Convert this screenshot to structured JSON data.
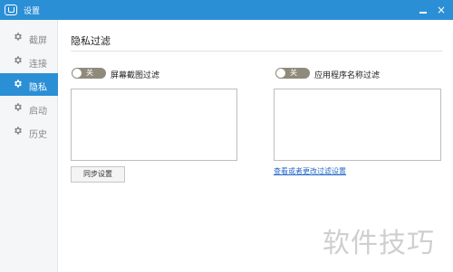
{
  "window": {
    "title": "设置",
    "minimize_glyph": "—",
    "close_glyph": "×"
  },
  "sidebar": {
    "items": [
      {
        "label": "截屏",
        "icon": "gear-icon",
        "active": false
      },
      {
        "label": "连接",
        "icon": "gear-icon",
        "active": false
      },
      {
        "label": "隐私",
        "icon": "gear-icon",
        "active": true
      },
      {
        "label": "启动",
        "icon": "gear-icon",
        "active": false
      },
      {
        "label": "历史",
        "icon": "gear-icon",
        "active": false
      }
    ]
  },
  "main": {
    "title": "隐私过滤",
    "screen_filter": {
      "toggle_state": "关",
      "label": "屏幕截图过滤"
    },
    "app_filter": {
      "toggle_state": "关",
      "label": "应用程序名称过滤"
    },
    "sync_button": "同步设置",
    "settings_link": "查看或者更改过滤设置"
  },
  "watermark": "软件技巧",
  "colors": {
    "accent": "#2b8fd6",
    "toggle_off": "#8f8a7c",
    "link": "#2468c7"
  }
}
